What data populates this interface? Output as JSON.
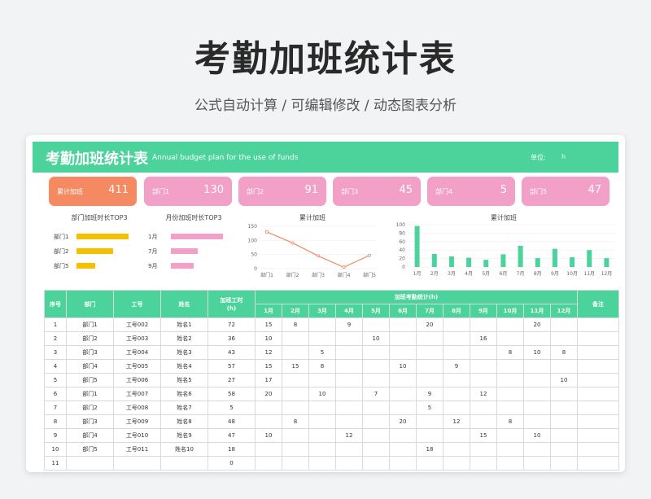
{
  "page": {
    "title": "考勤加班统计表",
    "subtitle": "公式自动计算 /  可编辑修改  /  动态图表分析"
  },
  "banner": {
    "title": "考勤加班统计表",
    "subtitle": "Annual budget plan for the use of funds",
    "unit_label": "单位:",
    "unit_value": "h"
  },
  "kpis": [
    {
      "label": "累计加班",
      "value": "411",
      "color": "#f58a62"
    },
    {
      "label": "部门1",
      "value": "130",
      "color": "#f2a0c7"
    },
    {
      "label": "部门2",
      "value": "91",
      "color": "#f2a0c7"
    },
    {
      "label": "部门3",
      "value": "45",
      "color": "#f2a0c7"
    },
    {
      "label": "部门4",
      "value": "5",
      "color": "#f2a0c7"
    },
    {
      "label": "部门5",
      "value": "47",
      "color": "#f2a0c7"
    }
  ],
  "chart_data": [
    {
      "type": "bar",
      "orientation": "horizontal",
      "title": "部门加班时长TOP3",
      "categories": [
        "部门1",
        "部门2",
        "部门5"
      ],
      "values": [
        130,
        91,
        47
      ],
      "color": "#f5c000"
    },
    {
      "type": "bar",
      "orientation": "horizontal",
      "title": "月份加班时长TOP3",
      "categories": [
        "1月",
        "7月",
        "9月"
      ],
      "values": [
        97,
        50,
        43
      ],
      "color": "#f2a0c7"
    },
    {
      "type": "line",
      "title": "累计加班",
      "categories": [
        "部门1",
        "部门2",
        "部门3",
        "部门4",
        "部门5"
      ],
      "values": [
        130,
        91,
        45,
        5,
        47
      ],
      "yticks": [
        0,
        50,
        100,
        150
      ],
      "ylim": [
        0,
        150
      ],
      "color": "#ee8a62"
    },
    {
      "type": "bar",
      "title": "累计加班",
      "categories": [
        "1月",
        "2月",
        "3月",
        "4月",
        "5月",
        "6月",
        "7月",
        "8月",
        "9月",
        "10月",
        "11月",
        "12月"
      ],
      "values": [
        97,
        31,
        25,
        22,
        17,
        30,
        50,
        21,
        43,
        23,
        40,
        21
      ],
      "yticks": [
        0,
        20,
        40,
        60,
        80,
        100
      ],
      "ylim": [
        0,
        100
      ],
      "color": "#4cd29b"
    }
  ],
  "table": {
    "headers": {
      "index": "序号",
      "dept": "部门",
      "id": "工号",
      "name": "姓名",
      "hours": "加班工时\n(h)",
      "months_group": "加班考勤统计(h)",
      "notes": "备注"
    },
    "months": [
      "1月",
      "2月",
      "3月",
      "4月",
      "5月",
      "6月",
      "7月",
      "8月",
      "9月",
      "10月",
      "11月",
      "12月"
    ],
    "rows": [
      {
        "no": "1",
        "dept": "部门1",
        "id": "工号002",
        "name": "姓名1",
        "total": "72",
        "m": [
          "15",
          "8",
          "",
          "9",
          "",
          "",
          "20",
          "",
          "",
          "",
          "20",
          ""
        ],
        "note": ""
      },
      {
        "no": "2",
        "dept": "部门2",
        "id": "工号003",
        "name": "姓名2",
        "total": "36",
        "m": [
          "10",
          "",
          "",
          "",
          "10",
          "",
          "",
          "",
          "16",
          "",
          "",
          ""
        ],
        "note": ""
      },
      {
        "no": "3",
        "dept": "部门3",
        "id": "工号004",
        "name": "姓名3",
        "total": "43",
        "m": [
          "12",
          "",
          "5",
          "",
          "",
          "",
          "",
          "",
          "",
          "8",
          "10",
          "8"
        ],
        "note": ""
      },
      {
        "no": "4",
        "dept": "部门4",
        "id": "工号005",
        "name": "姓名4",
        "total": "57",
        "m": [
          "15",
          "15",
          "8",
          "",
          "",
          "10",
          "",
          "9",
          "",
          "",
          "",
          ""
        ],
        "note": ""
      },
      {
        "no": "5",
        "dept": "部门5",
        "id": "工号006",
        "name": "姓名5",
        "total": "27",
        "m": [
          "17",
          "",
          "",
          "",
          "",
          "",
          "",
          "",
          "",
          "",
          "",
          "10"
        ],
        "note": ""
      },
      {
        "no": "6",
        "dept": "部门1",
        "id": "工号007",
        "name": "姓名6",
        "total": "58",
        "m": [
          "20",
          "",
          "10",
          "",
          "7",
          "",
          "9",
          "",
          "12",
          "",
          "",
          ""
        ],
        "note": ""
      },
      {
        "no": "7",
        "dept": "部门2",
        "id": "工号008",
        "name": "姓名7",
        "total": "5",
        "m": [
          "",
          "",
          "",
          "",
          "",
          "",
          "5",
          "",
          "",
          "",
          "",
          ""
        ],
        "note": ""
      },
      {
        "no": "8",
        "dept": "部门3",
        "id": "工号009",
        "name": "姓名8",
        "total": "48",
        "m": [
          "",
          "8",
          "",
          "",
          "",
          "20",
          "",
          "12",
          "",
          "8",
          "",
          ""
        ],
        "note": ""
      },
      {
        "no": "9",
        "dept": "部门4",
        "id": "工号010",
        "name": "姓名9",
        "total": "47",
        "m": [
          "10",
          "",
          "",
          "12",
          "",
          "",
          "",
          "",
          "15",
          "",
          "10",
          ""
        ],
        "note": ""
      },
      {
        "no": "10",
        "dept": "部门5",
        "id": "工号011",
        "name": "姓名10",
        "total": "18",
        "m": [
          "",
          "",
          "",
          "",
          "",
          "",
          "18",
          "",
          "",
          "",
          "",
          ""
        ],
        "note": ""
      },
      {
        "no": "11",
        "dept": "",
        "id": "",
        "name": "",
        "total": "0",
        "m": [
          "",
          "",
          "",
          "",
          "",
          "",
          "",
          "",
          "",
          "",
          "",
          ""
        ],
        "note": ""
      }
    ]
  },
  "colors": {
    "accent": "#4cd29b",
    "kpi_total": "#f58a62",
    "kpi_dept": "#f2a0c7",
    "bar_yellow": "#f5c000"
  }
}
